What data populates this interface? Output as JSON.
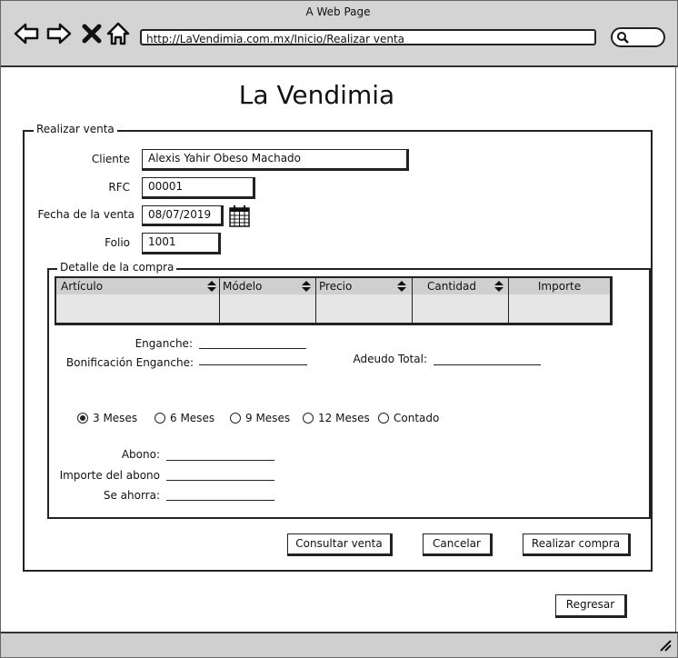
{
  "browser": {
    "window_title": "A Web Page",
    "url": "http://LaVendimia.com.mx/Inicio/Realizar venta",
    "icons": [
      "back-arrow-icon",
      "forward-arrow-icon",
      "close-x-icon",
      "home-icon",
      "search-icon"
    ]
  },
  "app": {
    "title": "La Vendimia"
  },
  "sale": {
    "legend": "Realizar venta",
    "cliente_label": "Cliente",
    "cliente_value": "Alexis Yahir Obeso Machado",
    "rfc_label": "RFC",
    "rfc_value": "00001",
    "fecha_label": "Fecha de la venta",
    "fecha_value": "08/07/2019",
    "folio_label": "Folio",
    "folio_value": "1001"
  },
  "detail": {
    "legend": "Detalle de la compra",
    "columns": [
      "Artículo",
      "Módelo",
      "Precio",
      "Cantidad",
      "Importe"
    ],
    "enganche_label": "Enganche:",
    "bonificacion_label": "Bonificación Enganche:",
    "adeudo_label": "Adeudo Total:",
    "plazos": [
      {
        "label": "3 Meses",
        "selected": true
      },
      {
        "label": "6 Meses",
        "selected": false
      },
      {
        "label": "9 Meses",
        "selected": false
      },
      {
        "label": "12 Meses",
        "selected": false
      },
      {
        "label": "Contado",
        "selected": false
      }
    ],
    "abono_label": "Abono:",
    "importe_abono_label": "Importe del abono",
    "ahorra_label": "Se ahorra:"
  },
  "buttons": {
    "consultar": "Consultar venta",
    "cancelar": "Cancelar",
    "realizar": "Realizar compra",
    "regresar": "Regresar"
  }
}
